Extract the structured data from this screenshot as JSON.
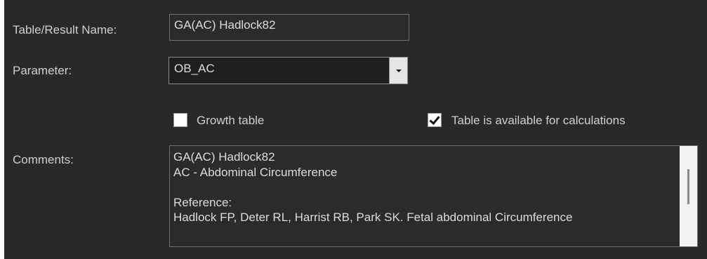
{
  "form": {
    "table_name_label": "Table/Result Name:",
    "table_name_value": "GA(AC) Hadlock82",
    "parameter_label": "Parameter:",
    "parameter_value": "OB_AC",
    "growth_table_label": "Growth table",
    "growth_table_checked": false,
    "available_label": "Table is available for calculations",
    "available_checked": true,
    "comments_label": "Comments:",
    "comments_lines": [
      "GA(AC) Hadlock82",
      "AC - Abdominal Circumference",
      "",
      "Reference:",
      "Hadlock FP, Deter RL, Harrist RB, Park SK. Fetal abdominal Circumference"
    ]
  },
  "icons": {
    "dropdown": "chevron-down-icon",
    "checkmark": "checkmark-icon"
  },
  "colors": {
    "background": "#292929",
    "text": "#dcdcdc",
    "border": "#6e6e6e"
  }
}
